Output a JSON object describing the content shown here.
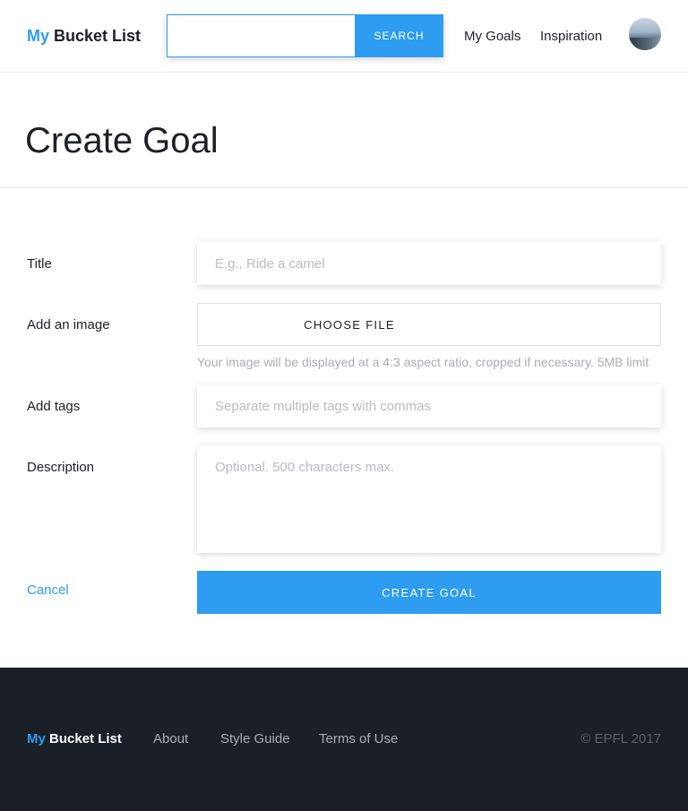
{
  "header": {
    "logo_accent": "My",
    "logo_rest": "Bucket List",
    "search_value": "",
    "search_button": "SEARCH",
    "nav": [
      "My Goals",
      "Inspiration"
    ]
  },
  "page_title": "Create Goal",
  "form": {
    "title_label": "Title",
    "title_placeholder": "E.g., Ride a camel",
    "image_label": "Add an image",
    "file_button": "CHOOSE FILE",
    "image_helper": "Your image will be displayed at a 4:3 aspect ratio, cropped if necessary. 5MB limit",
    "tags_label": "Add tags",
    "tags_placeholder": "Separate multiple tags with commas",
    "description_label": "Description",
    "description_placeholder": "Optional. 500 characters max.",
    "cancel": "Cancel",
    "submit": "CREATE GOAL"
  },
  "footer": {
    "logo_accent": "My",
    "logo_rest": "Bucket List",
    "links": [
      "About",
      "Style Guide",
      "Terms of Use"
    ],
    "copyright": "© EPFL 2017"
  },
  "colors": {
    "accent": "#2e9cf0",
    "footer_bg": "#1b1f27",
    "text": "#1c1f26"
  }
}
